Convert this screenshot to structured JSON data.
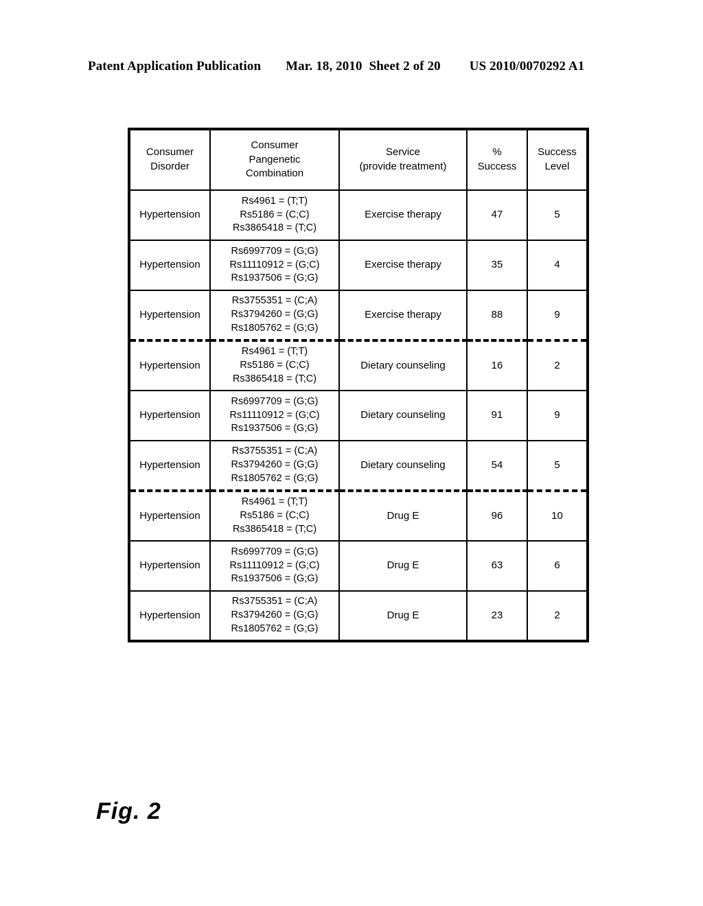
{
  "header": {
    "publication": "Patent Application Publication",
    "date": "Mar. 18, 2010",
    "sheet": "Sheet 2 of 20",
    "patent_number": "US 2010/0070292 A1"
  },
  "figure": {
    "caption": "Fig. 2"
  },
  "table": {
    "columns": [
      {
        "lines": [
          "Consumer",
          "Disorder"
        ]
      },
      {
        "lines": [
          "Consumer",
          "Pangenetic",
          "Combination"
        ]
      },
      {
        "lines": [
          "Service",
          "(provide treatment)"
        ]
      },
      {
        "lines": [
          "%",
          "Success"
        ]
      },
      {
        "lines": [
          "Success",
          "Level"
        ]
      }
    ],
    "rows": [
      {
        "disorder": "Hypertension",
        "combination": [
          "Rs4961 = (T;T)",
          "Rs5186 = (C;C)",
          "Rs3865418 = (T;C)"
        ],
        "service": "Exercise therapy",
        "percent_success": "47",
        "success_level": "5",
        "group_break": false
      },
      {
        "disorder": "Hypertension",
        "combination": [
          "Rs6997709 = (G;G)",
          "Rs11110912 = (G;C)",
          "Rs1937506 = (G;G)"
        ],
        "service": "Exercise therapy",
        "percent_success": "35",
        "success_level": "4",
        "group_break": false
      },
      {
        "disorder": "Hypertension",
        "combination": [
          "Rs3755351 = (C;A)",
          "Rs3794260 = (G;G)",
          "Rs1805762 = (G;G)"
        ],
        "service": "Exercise therapy",
        "percent_success": "88",
        "success_level": "9",
        "group_break": false
      },
      {
        "disorder": "Hypertension",
        "combination": [
          "Rs4961 = (T;T)",
          "Rs5186 = (C;C)",
          "Rs3865418 = (T;C)"
        ],
        "service": "Dietary counseling",
        "percent_success": "16",
        "success_level": "2",
        "group_break": true
      },
      {
        "disorder": "Hypertension",
        "combination": [
          "Rs6997709 = (G;G)",
          "Rs11110912 = (G;C)",
          "Rs1937506 = (G;G)"
        ],
        "service": "Dietary counseling",
        "percent_success": "91",
        "success_level": "9",
        "group_break": false
      },
      {
        "disorder": "Hypertension",
        "combination": [
          "Rs3755351 = (C;A)",
          "Rs3794260 = (G;G)",
          "Rs1805762 = (G;G)"
        ],
        "service": "Dietary counseling",
        "percent_success": "54",
        "success_level": "5",
        "group_break": false
      },
      {
        "disorder": "Hypertension",
        "combination": [
          "Rs4961 = (T;T)",
          "Rs5186 = (C;C)",
          "Rs3865418 = (T;C)"
        ],
        "service": "Drug E",
        "percent_success": "96",
        "success_level": "10",
        "group_break": true
      },
      {
        "disorder": "Hypertension",
        "combination": [
          "Rs6997709 = (G;G)",
          "Rs11110912 = (G;C)",
          "Rs1937506 = (G;G)"
        ],
        "service": "Drug E",
        "percent_success": "63",
        "success_level": "6",
        "group_break": false
      },
      {
        "disorder": "Hypertension",
        "combination": [
          "Rs3755351 = (C;A)",
          "Rs3794260 = (G;G)",
          "Rs1805762 = (G;G)"
        ],
        "service": "Drug E",
        "percent_success": "23",
        "success_level": "2",
        "group_break": false
      }
    ]
  }
}
